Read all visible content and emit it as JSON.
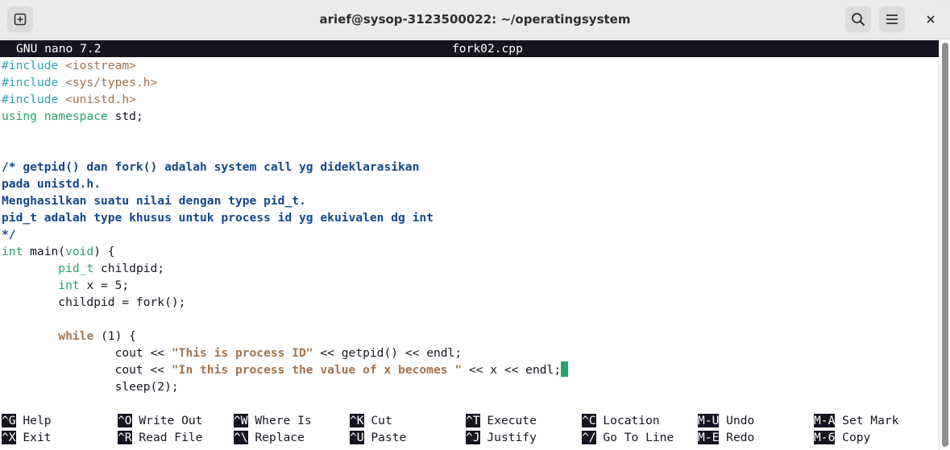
{
  "window": {
    "title": "arief@sysop-3123500022: ~/operatingsystem"
  },
  "titlebar_icons": {
    "new_tab": "new-tab-icon",
    "search": "search-icon",
    "menu": "hamburger-menu-icon",
    "close": "close-icon"
  },
  "nano": {
    "version": "GNU nano 7.2",
    "filename": "fork02.cpp"
  },
  "code": {
    "l1a": "#include ",
    "l1b": "<iostream>",
    "l2a": "#include ",
    "l2b": "<sys/types.h>",
    "l3a": "#include ",
    "l3b": "<unistd.h>",
    "l4a": "using",
    "l4b": " ",
    "l4c": "namespace",
    "l4d": " std;",
    "l7": "/* getpid() dan fork() adalah system call yg dideklarasikan",
    "l8": "pada unistd.h.",
    "l9": "Menghasilkan suatu nilai dengan type pid_t.",
    "l10": "pid_t adalah type khusus untuk process id yg ekuivalen dg int",
    "l11": "*/",
    "l12a": "int",
    "l12b": " main(",
    "l12c": "void",
    "l12d": ") {",
    "l13a": "        ",
    "l13b": "pid_t",
    "l13c": " childpid;",
    "l14a": "        ",
    "l14b": "int",
    "l14c": " x = 5;",
    "l15": "        childpid = fork();",
    "l17a": "        ",
    "l17b": "while",
    "l17c": " (1) {",
    "l18a": "                cout << ",
    "l18b": "\"This is process ID\"",
    "l18c": " << getpid() << endl;",
    "l19a": "                cout << ",
    "l19b": "\"In this process the value of x becomes \"",
    "l19c": " << x << endl;",
    "l20": "                sleep(2);"
  },
  "shortcuts": [
    {
      "key": "^G",
      "label": "Help"
    },
    {
      "key": "^O",
      "label": "Write Out"
    },
    {
      "key": "^W",
      "label": "Where Is"
    },
    {
      "key": "^K",
      "label": "Cut"
    },
    {
      "key": "^T",
      "label": "Execute"
    },
    {
      "key": "^C",
      "label": "Location"
    },
    {
      "key": "M-U",
      "label": "Undo"
    },
    {
      "key": "M-A",
      "label": "Set Mark"
    },
    {
      "key": "^X",
      "label": "Exit"
    },
    {
      "key": "^R",
      "label": "Read File"
    },
    {
      "key": "^\\",
      "label": "Replace"
    },
    {
      "key": "^U",
      "label": "Paste"
    },
    {
      "key": "^J",
      "label": "Justify"
    },
    {
      "key": "^/",
      "label": "Go To Line"
    },
    {
      "key": "M-E",
      "label": "Redo"
    },
    {
      "key": "M-6",
      "label": "Copy"
    }
  ],
  "colors": {
    "keyword": "#26a269",
    "preprocessor": "#2aa1b3",
    "include_path": "#a2734c",
    "comment": "#12488b",
    "string": "#a2734c",
    "cursor": "#26a269"
  }
}
